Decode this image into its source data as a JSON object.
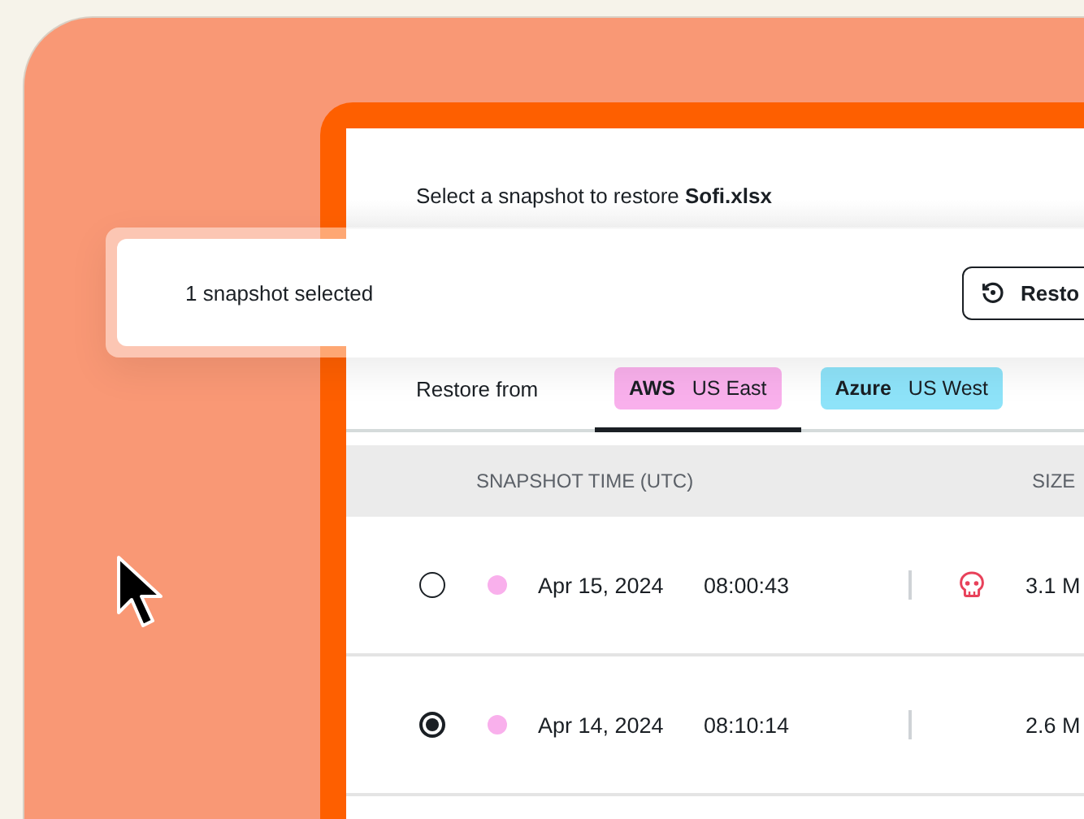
{
  "dialog": {
    "prompt": "Select a snapshot to restore **Sofi.xlsx**"
  },
  "selection_bar": {
    "label": "1 snapshot selected",
    "button": "Resto"
  },
  "restore_from": {
    "label": "Restore from",
    "tabs": [
      {
        "provider": "AWS",
        "region": "US East",
        "color": "#f9b0ec",
        "selected": true
      },
      {
        "provider": "Azure",
        "region": "US West",
        "color": "#8ee3f9",
        "selected": false
      }
    ]
  },
  "table": {
    "columns": [
      "SNAPSHOT TIME (UTC)",
      "SIZE"
    ],
    "rows": [
      {
        "selected": false,
        "color": "#f9b0ec",
        "date": "Apr 15, 2024",
        "time": "08:00:43",
        "flagged": true,
        "size": "3.1 M"
      },
      {
        "selected": true,
        "color": "#f9b0ec",
        "date": "Apr 14, 2024",
        "time": "08:10:14",
        "flagged": false,
        "size": "2.6 M"
      }
    ]
  }
}
